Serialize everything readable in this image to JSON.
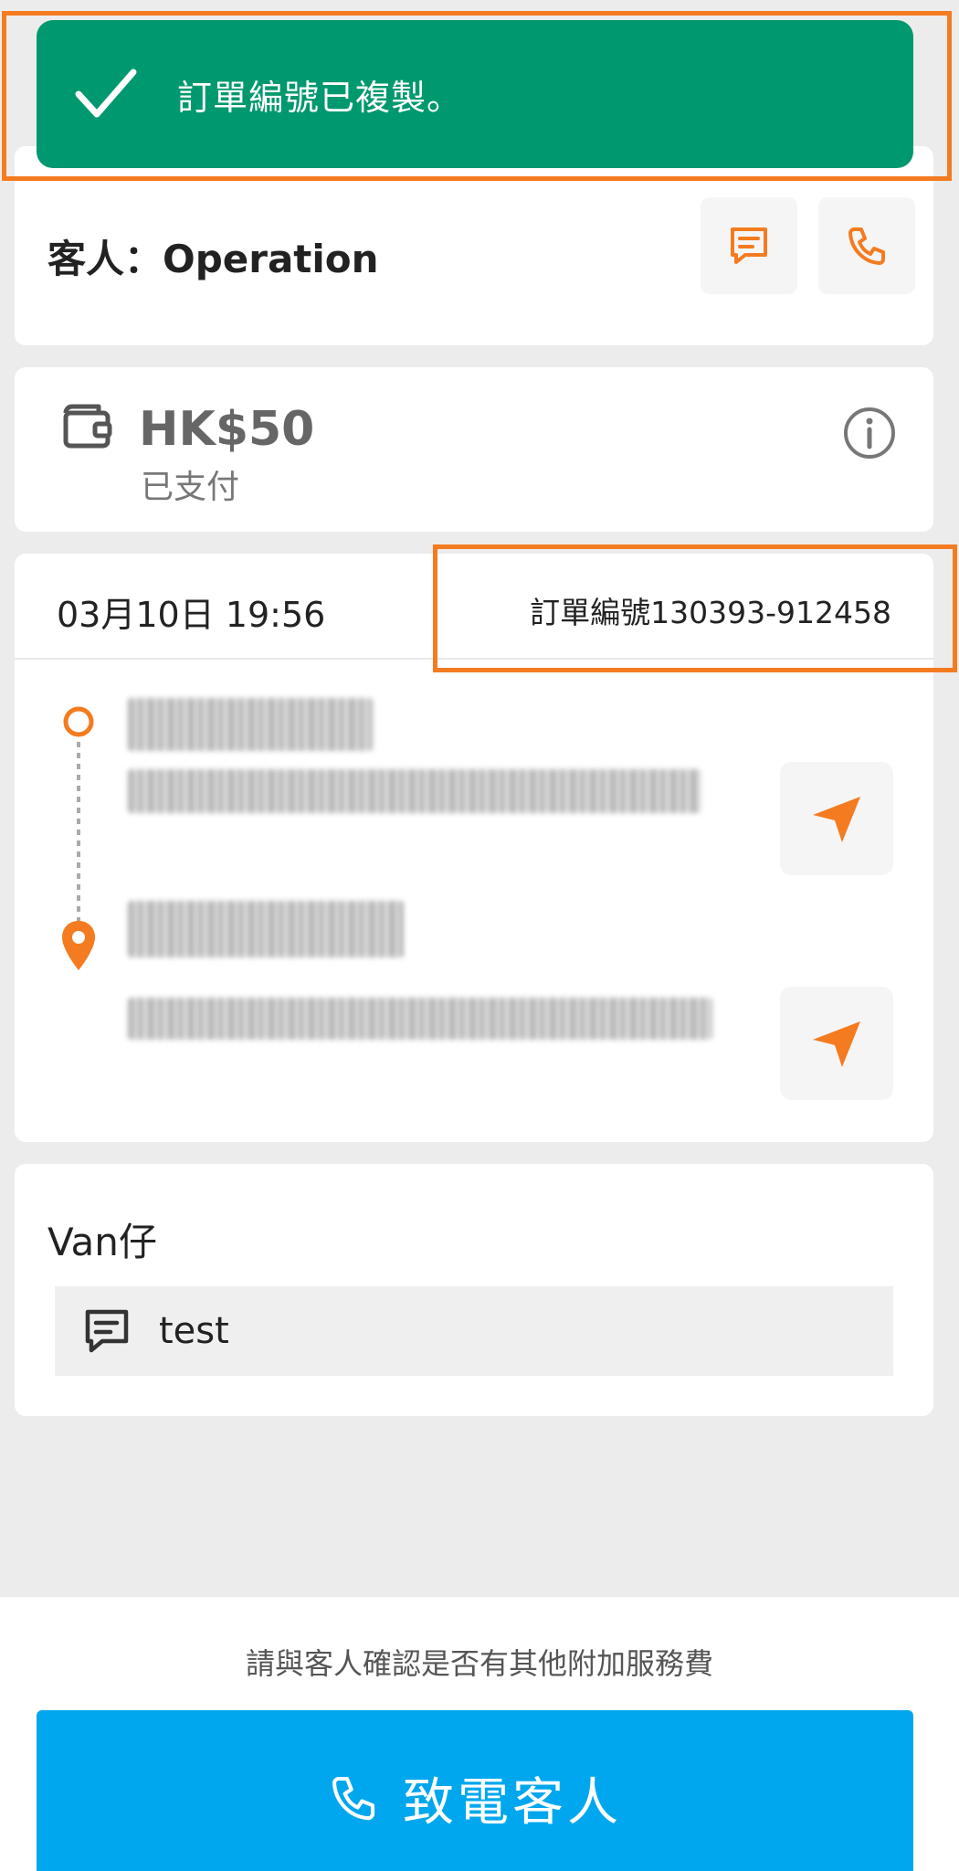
{
  "toast": {
    "message": "訂單編號已複製。",
    "icon": "check-icon"
  },
  "customer": {
    "label": "客人：Operation",
    "message_icon": "message-icon",
    "phone_icon": "phone-icon"
  },
  "payment": {
    "amount": "HK$50",
    "status": "已支付",
    "wallet_icon": "wallet-icon",
    "info_icon": "info-icon"
  },
  "order": {
    "datetime": "03月10日 19:56",
    "order_number": "訂單編號130393-912458"
  },
  "driver": {
    "label": "Van仔",
    "note": "test",
    "note_icon": "message-icon"
  },
  "footer": {
    "hint": "請與客人確認是否有其他附加服務費",
    "call_button": "致電客人",
    "call_icon": "phone-icon"
  },
  "colors": {
    "toast_bg": "#00986e",
    "accent_orange": "#f47b20",
    "call_button_bg": "#00a7ee"
  }
}
